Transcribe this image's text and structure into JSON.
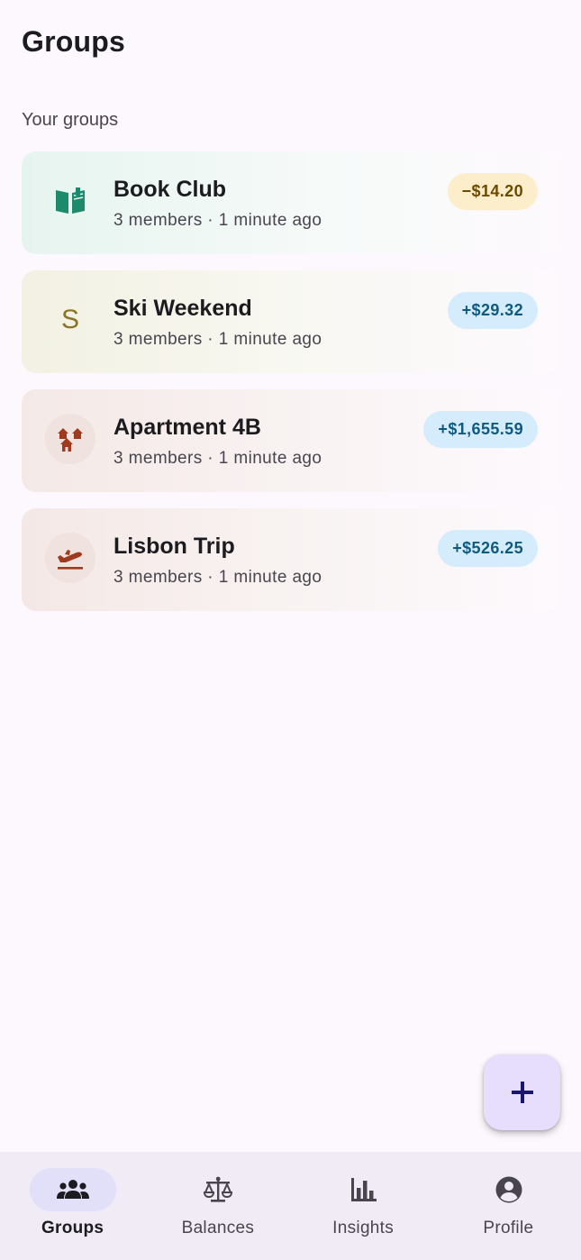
{
  "header": {
    "title": "Groups"
  },
  "section": {
    "label": "Your groups"
  },
  "groups": [
    {
      "name": "Book Club",
      "subtitle": "3 members · 1 minute ago",
      "balance": "−$14.20",
      "icon": "book-icon",
      "colors": {
        "tint": "#e6f4ef",
        "icon": "#1d8a6c",
        "badge_bg": "#fdeecb",
        "badge_fg": "#6b4a00"
      }
    },
    {
      "name": "Ski Weekend",
      "subtitle": "3 members · 1 minute ago",
      "balance": "+$29.32",
      "icon": "initial-s",
      "initial": "S",
      "colors": {
        "tint": "#f2f1e3",
        "icon": "#8a7426",
        "badge_bg": "#d5ecfd",
        "badge_fg": "#0f5a80"
      }
    },
    {
      "name": "Apartment 4B",
      "subtitle": "3 members · 1 minute ago",
      "balance": "+$1,655.59",
      "icon": "houses-icon",
      "colors": {
        "tint": "#f4e9e6",
        "icon": "#9e3a1d",
        "badge_bg": "#d5ecfd",
        "badge_fg": "#0f5a80"
      }
    },
    {
      "name": "Lisbon Trip",
      "subtitle": "3 members · 1 minute ago",
      "balance": "+$526.25",
      "icon": "flight-takeoff-icon",
      "colors": {
        "tint": "#f4e8e6",
        "icon": "#9e3a1d",
        "badge_bg": "#d5ecfd",
        "badge_fg": "#0f5a80"
      }
    }
  ],
  "fab": {
    "icon": "plus-icon",
    "color": "#1a1570"
  },
  "nav": {
    "items": [
      {
        "label": "Groups",
        "icon": "groups-icon",
        "active": true
      },
      {
        "label": "Balances",
        "icon": "scale-icon",
        "active": false
      },
      {
        "label": "Insights",
        "icon": "bar-chart-icon",
        "active": false
      },
      {
        "label": "Profile",
        "icon": "account-circle-icon",
        "active": false
      }
    ]
  }
}
